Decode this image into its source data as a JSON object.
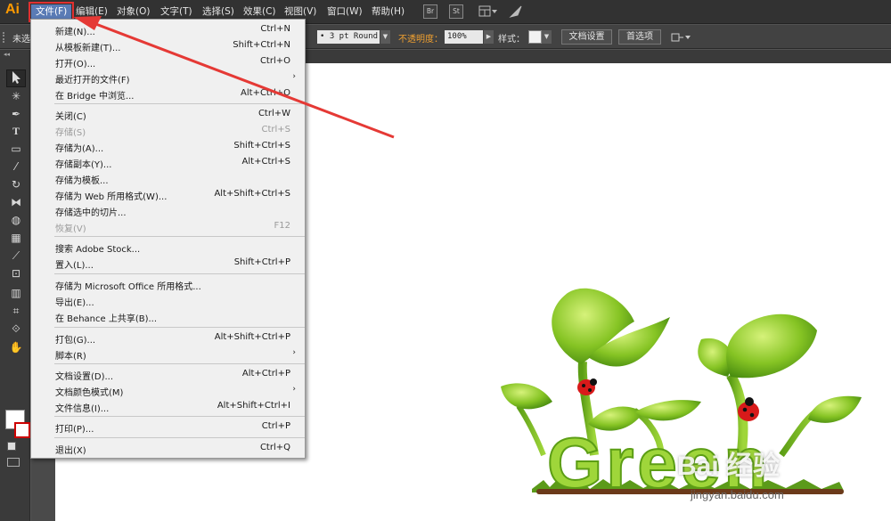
{
  "app": {
    "logo": "Ai"
  },
  "menubar": {
    "items": [
      {
        "id": "file",
        "label": "文件(F)"
      },
      {
        "id": "edit",
        "label": "编辑(E)"
      },
      {
        "id": "object",
        "label": "对象(O)"
      },
      {
        "id": "type",
        "label": "文字(T)"
      },
      {
        "id": "select",
        "label": "选择(S)"
      },
      {
        "id": "effect",
        "label": "效果(C)"
      },
      {
        "id": "view",
        "label": "视图(V)"
      },
      {
        "id": "window",
        "label": "窗口(W)"
      },
      {
        "id": "help",
        "label": "帮助(H)"
      }
    ],
    "bridge_btn": "Br",
    "stock_btn": "St"
  },
  "controlbar": {
    "selection_status": "未选",
    "stroke_profile": "3 pt Round",
    "opacity_label": "不透明度：",
    "opacity_value": "100%",
    "style_label": "样式：",
    "doc_setup_btn": "文档设置",
    "preferences_btn": "首选项"
  },
  "file_menu": {
    "items": [
      {
        "label": "新建(N)...",
        "shortcut": "Ctrl+N",
        "enabled": true
      },
      {
        "label": "从模板新建(T)...",
        "shortcut": "Shift+Ctrl+N",
        "enabled": true
      },
      {
        "label": "打开(O)...",
        "shortcut": "Ctrl+O",
        "enabled": true
      },
      {
        "label": "最近打开的文件(F)",
        "shortcut": "",
        "enabled": true,
        "submenu": true
      },
      {
        "label": "在 Bridge 中浏览...",
        "shortcut": "Alt+Ctrl+O",
        "enabled": true
      },
      {
        "label": "关闭(C)",
        "shortcut": "Ctrl+W",
        "enabled": true
      },
      {
        "label": "存储(S)",
        "shortcut": "Ctrl+S",
        "enabled": false
      },
      {
        "label": "存储为(A)...",
        "shortcut": "Shift+Ctrl+S",
        "enabled": true
      },
      {
        "label": "存储副本(Y)...",
        "shortcut": "Alt+Ctrl+S",
        "enabled": true
      },
      {
        "label": "存储为模板...",
        "shortcut": "",
        "enabled": true
      },
      {
        "label": "存储为 Web 所用格式(W)...",
        "shortcut": "Alt+Shift+Ctrl+S",
        "enabled": true
      },
      {
        "label": "存储选中的切片...",
        "shortcut": "",
        "enabled": true
      },
      {
        "label": "恢复(V)",
        "shortcut": "F12",
        "enabled": false
      },
      {
        "label": "搜索 Adobe Stock...",
        "shortcut": "",
        "enabled": true
      },
      {
        "label": "置入(L)...",
        "shortcut": "Shift+Ctrl+P",
        "enabled": true
      },
      {
        "label": "存储为 Microsoft Office 所用格式...",
        "shortcut": "",
        "enabled": true
      },
      {
        "label": "导出(E)...",
        "shortcut": "",
        "enabled": true
      },
      {
        "label": "在 Behance 上共享(B)...",
        "shortcut": "",
        "enabled": true
      },
      {
        "label": "打包(G)...",
        "shortcut": "Alt+Shift+Ctrl+P",
        "enabled": true
      },
      {
        "label": "脚本(R)",
        "shortcut": "",
        "enabled": true,
        "submenu": true
      },
      {
        "label": "文档设置(D)...",
        "shortcut": "Alt+Ctrl+P",
        "enabled": true
      },
      {
        "label": "文档颜色模式(M)",
        "shortcut": "",
        "enabled": true,
        "submenu": true
      },
      {
        "label": "文件信息(I)...",
        "shortcut": "Alt+Shift+Ctrl+I",
        "enabled": true
      },
      {
        "label": "打印(P)...",
        "shortcut": "Ctrl+P",
        "enabled": true
      },
      {
        "label": "退出(X)",
        "shortcut": "Ctrl+Q",
        "enabled": true
      }
    ]
  },
  "artwork": {
    "word": "Green"
  },
  "watermark": {
    "brand": "Bai  经验",
    "url": "jingyan.baidu.com"
  },
  "colors": {
    "accent": "#ff9a00",
    "highlight_box": "#e03030",
    "arrow": "#e53935",
    "leaf_green": "#7cc11f"
  }
}
